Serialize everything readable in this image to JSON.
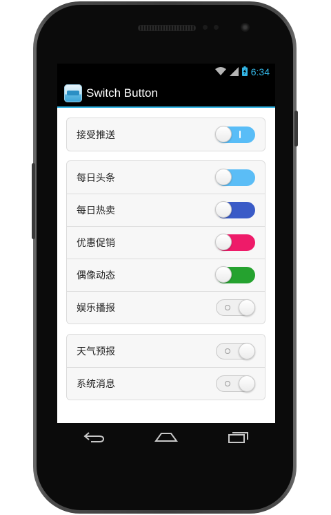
{
  "status_bar": {
    "time": "6:34"
  },
  "app": {
    "title": "Switch Button",
    "icon": "app-drawer-icon"
  },
  "colors": {
    "holo_blue": "#33b5e5"
  },
  "groups": [
    {
      "items": [
        {
          "label": "接受推送",
          "state": "on",
          "color": "#59bdf7"
        }
      ]
    },
    {
      "items": [
        {
          "label": "每日头条",
          "state": "on",
          "color": "#5bbdf6"
        },
        {
          "label": "每日热卖",
          "state": "on",
          "color": "#3a5bc7"
        },
        {
          "label": "优惠促销",
          "state": "on",
          "color": "#ee1b69"
        },
        {
          "label": "偶像动态",
          "state": "on",
          "color": "#25a22f"
        },
        {
          "label": "娱乐播报",
          "state": "off",
          "color": "#f0f0f0"
        }
      ]
    },
    {
      "items": [
        {
          "label": "天气预报",
          "state": "off",
          "color": "#f0f0f0"
        },
        {
          "label": "系统消息",
          "state": "off",
          "color": "#f0f0f0"
        }
      ]
    }
  ],
  "nav": {
    "back": "back-icon",
    "home": "home-icon",
    "recents": "recents-icon"
  }
}
